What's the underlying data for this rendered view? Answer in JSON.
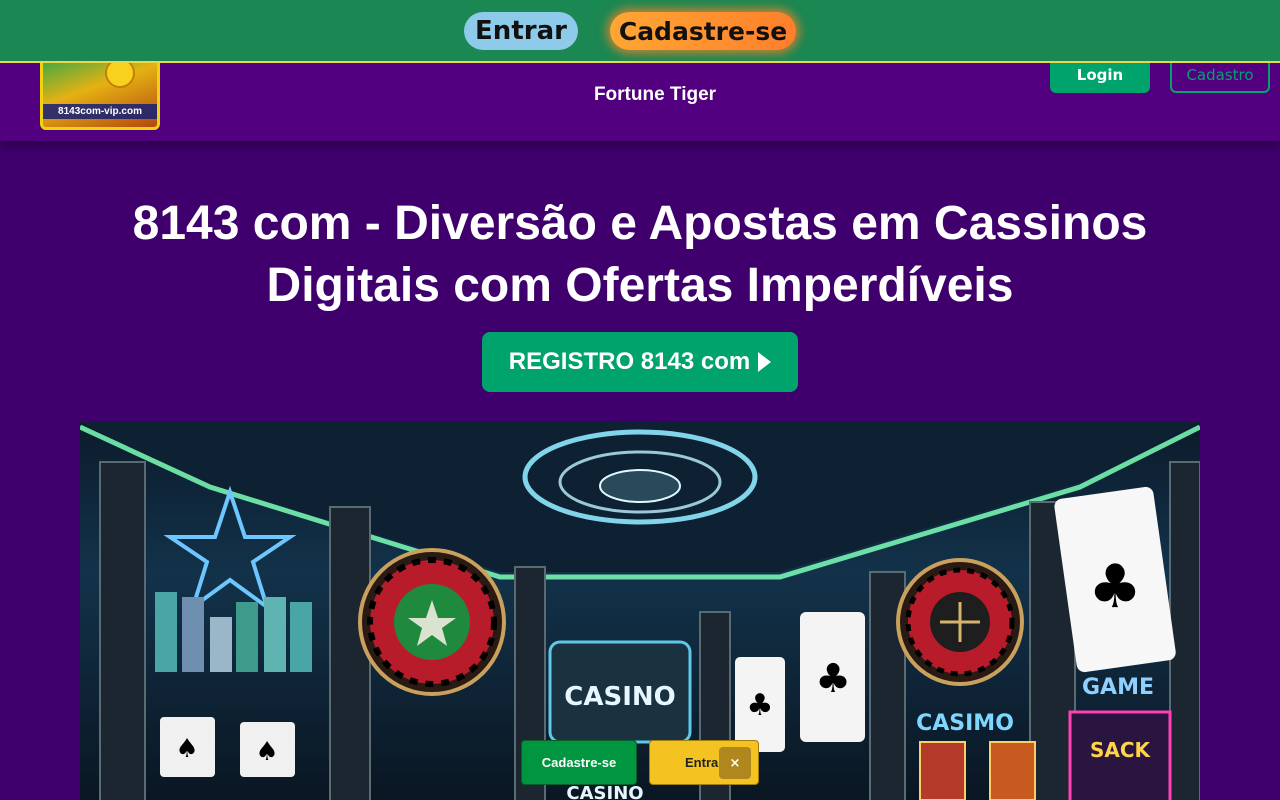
{
  "promo_bar": {
    "entrar_label": "Entrar",
    "cadastre_label": "Cadastre-se"
  },
  "header": {
    "logo_text": "8143com-vip.com",
    "nav_link": "Fortune Tiger",
    "login_label": "Login",
    "cadastro_label": "Cadastro"
  },
  "hero": {
    "title": "8143 com - Diversão e Apostas em Cassinos Digitais com Ofertas Imperdíveis",
    "cta_label": "REGISTRO 8143 com",
    "image_signs": {
      "casino_center": "CASINO",
      "casino_right": "CASIMO",
      "game": "GAME",
      "sack": "SACK",
      "casino_bottom": "CASINO"
    }
  },
  "floating_bar": {
    "cadastre_label": "Cadastre-se",
    "entrar_label": "Entrar",
    "close_glyph": "×"
  },
  "colors": {
    "background": "#3f006e",
    "header": "#52007f",
    "promo_bar": "#1b8752",
    "accent_green": "#00a36c",
    "accent_orange": "#ff8c2e",
    "accent_yellow": "#f4c321"
  }
}
